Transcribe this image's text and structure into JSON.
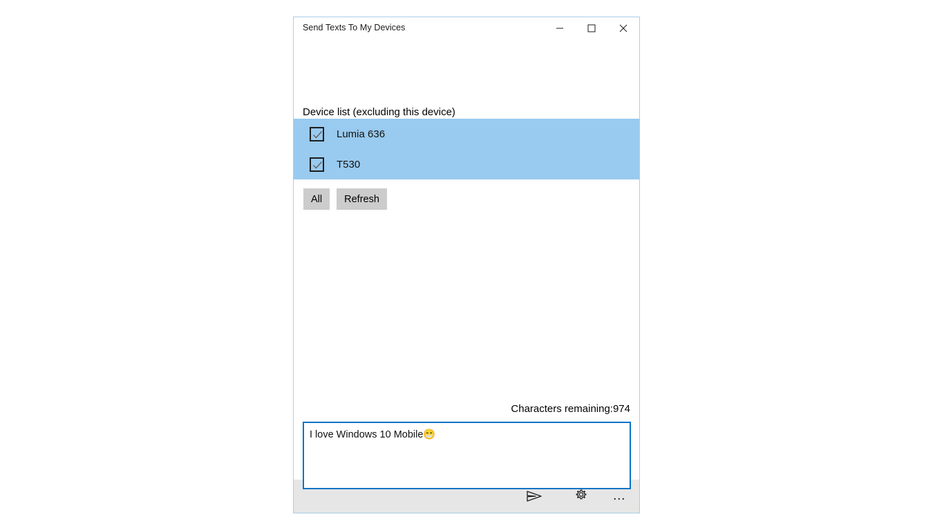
{
  "window": {
    "title": "Send Texts To My Devices",
    "controls": {
      "minimize": "minimize-button",
      "maximize": "maximize-button",
      "close": "close-button"
    }
  },
  "device_section": {
    "label": "Device list (excluding this device)",
    "selection_color": "#99caef",
    "devices": [
      {
        "name": "Lumia 636",
        "checked": true
      },
      {
        "name": "T530",
        "checked": true
      }
    ]
  },
  "actions": {
    "all_label": "All",
    "refresh_label": "Refresh"
  },
  "composer": {
    "characters_remaining_label": "Characters remaining:974",
    "message_text": "I love Windows 10 Mobile😁",
    "focus_border_color": "#0273c6"
  },
  "command_bar": {
    "background": "#e6e6e6",
    "items": [
      {
        "icon": "send-icon",
        "name": "send-button"
      },
      {
        "icon": "gear-icon",
        "name": "settings-button"
      },
      {
        "icon": "ellipsis-icon",
        "name": "more-button",
        "glyph": "• • •"
      }
    ]
  }
}
